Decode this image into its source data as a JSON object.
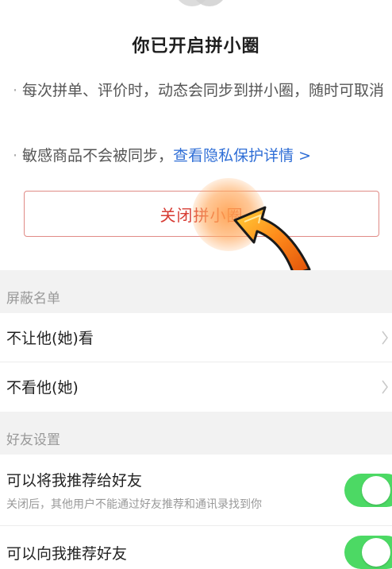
{
  "header": {
    "title": "你已开启拼小圈"
  },
  "bullets": [
    {
      "text": "每次拼单、评价时，动态会同步到拼小圈，随时可取消"
    },
    {
      "text": "敏感商品不会被同步，",
      "link": "查看隐私保护详情 >"
    }
  ],
  "close_button": {
    "label": "关闭拼小圈"
  },
  "block_list": {
    "section_title": "屏蔽名单",
    "items": [
      {
        "label": "不让他(她)看",
        "icon": "chevron-right-icon"
      },
      {
        "label": "不看他(她)",
        "icon": "chevron-right-icon"
      }
    ]
  },
  "friend_settings": {
    "section_title": "好友设置",
    "items": [
      {
        "label": "可以将我推荐给好友",
        "description": "关闭后，其他用户不能通过好友推荐和通讯录找到你",
        "toggle_on": true
      },
      {
        "label": "可以向我推荐好友",
        "toggle_on": true
      }
    ]
  },
  "colors": {
    "accent_red": "#d73c34",
    "link_blue": "#2f6ed6",
    "toggle_green": "#4cd964",
    "section_bg": "#f2f2f2"
  }
}
